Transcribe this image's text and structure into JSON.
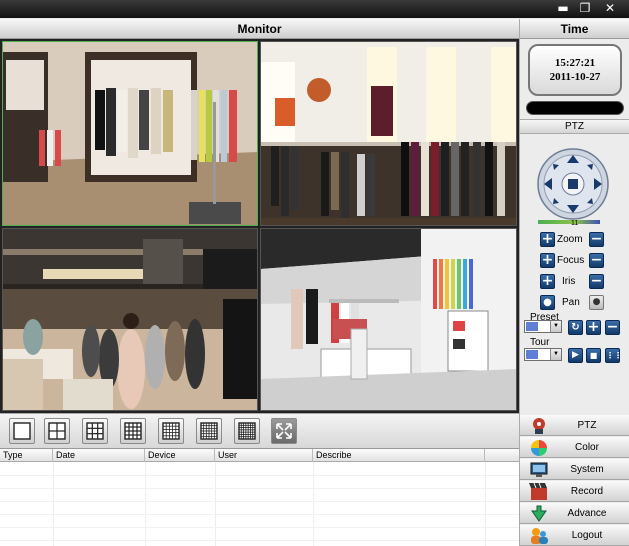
{
  "window": {
    "minimize_icon": "minimize-icon",
    "restore_icon": "restore-icon",
    "close_icon": "close-icon"
  },
  "monitor": {
    "title": "Monitor"
  },
  "cameras": [
    {
      "name": "camera-1",
      "scene": "boutique-clothing-racks"
    },
    {
      "name": "camera-2",
      "scene": "dress-shop-display"
    },
    {
      "name": "camera-3",
      "scene": "crowded-store-floor"
    },
    {
      "name": "camera-4",
      "scene": "white-showroom"
    }
  ],
  "layout_buttons": [
    "1x1",
    "2x2",
    "3x3",
    "4x4",
    "5x5",
    "6x6",
    "7x7",
    "fullscreen"
  ],
  "log": {
    "columns": [
      "Type",
      "Date",
      "Device",
      "User",
      "Describe"
    ]
  },
  "time_panel": {
    "title": "Time",
    "time": "15:27:21",
    "date": "2011-10-27"
  },
  "ptz": {
    "title": "PTZ",
    "speed_value": "11",
    "controls": [
      {
        "label": "Zoom"
      },
      {
        "label": "Focus"
      },
      {
        "label": "Iris"
      },
      {
        "label": "Pan"
      }
    ],
    "preset_label": "Preset",
    "tour_label": "Tour"
  },
  "menu": [
    {
      "label": "PTZ",
      "icon": "ptz-icon"
    },
    {
      "label": "Color",
      "icon": "color-icon"
    },
    {
      "label": "System",
      "icon": "system-icon"
    },
    {
      "label": "Record",
      "icon": "record-icon"
    },
    {
      "label": "Advance",
      "icon": "advance-icon"
    },
    {
      "label": "Logout",
      "icon": "logout-icon"
    }
  ],
  "colors": {
    "accent_blue": "#123a6a",
    "cam_active_border": "#4caf50"
  }
}
